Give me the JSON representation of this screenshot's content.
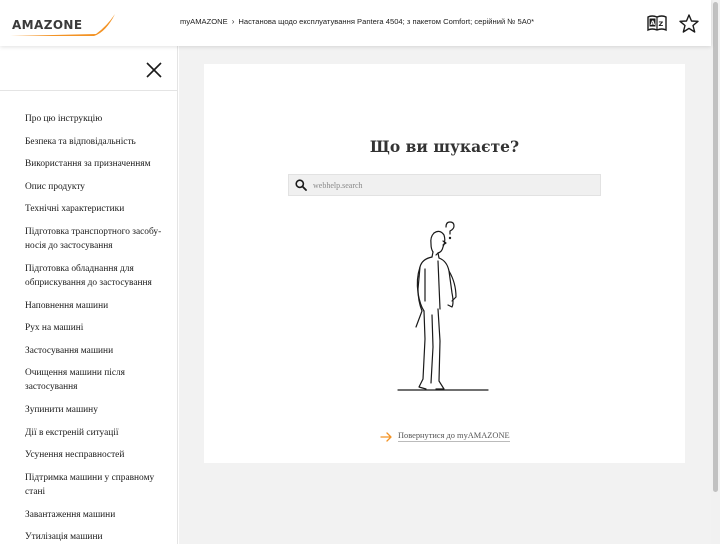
{
  "header": {
    "logo_text": "AMAZONE",
    "breadcrumb": {
      "root": "myAMAZONE",
      "separator": "›",
      "current": "Настанова щодо експлуатування Pantera 4504; з пакетом Comfort; серійний № 5А0*"
    },
    "icons": [
      "dictionary-icon",
      "star-icon"
    ]
  },
  "sidebar": {
    "items": [
      {
        "label": "Про цю інструкцію"
      },
      {
        "label": "Безпека та відповідальність"
      },
      {
        "label": "Використання за призначенням"
      },
      {
        "label": "Опис продукту"
      },
      {
        "label": "Технічні характеристики"
      },
      {
        "label": "Підготовка транспортного засобу-носія до застосування"
      },
      {
        "label": "Підготовка обладнання для обприскування до застосування"
      },
      {
        "label": "Наповнення машини"
      },
      {
        "label": "Рух на машині"
      },
      {
        "label": "Застосування машини"
      },
      {
        "label": "Очищення машини після застосування"
      },
      {
        "label": "Зупинити машину"
      },
      {
        "label": "Дії в екстреній ситуації"
      },
      {
        "label": "Усунення несправностей"
      },
      {
        "label": "Підтримка машини у справному стані"
      },
      {
        "label": "Завантаження машини"
      },
      {
        "label": "Утилізація машини"
      }
    ]
  },
  "main": {
    "title": "Що ви шукаєте?",
    "search_placeholder": "webhelp.search",
    "search_value": "",
    "back_link": "Повернутися до myAMAZONE"
  },
  "colors": {
    "accent": "#f39325",
    "text": "#1a1a1a",
    "background": "#f2f2f2"
  }
}
